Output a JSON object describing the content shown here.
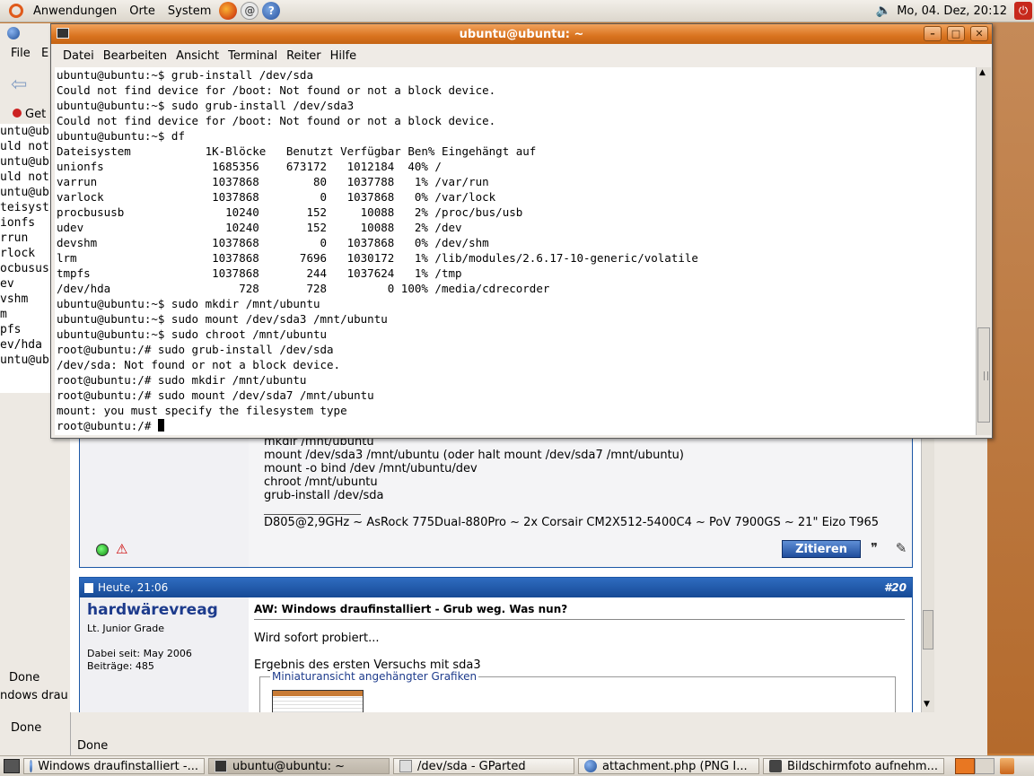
{
  "top_panel": {
    "menus": [
      "Anwendungen",
      "Orte",
      "System"
    ],
    "clock": "Mo, 04. Dez, 20:12",
    "icons": [
      "ubuntu-logo-icon",
      "firefox-icon",
      "mail-icon",
      "help-icon",
      "volume-icon",
      "power-icon"
    ],
    "help_glyph": "?",
    "power_glyph": "⏻",
    "volume_glyph": "🔈"
  },
  "browser": {
    "menu_file": "File",
    "menu_edit": "E",
    "get_label": "Get",
    "term_list": [
      "untu@ub",
      "uld not",
      "untu@ub",
      "uld not",
      "untu@ub",
      "teisyst",
      "ionfs",
      "rrun",
      "rlock",
      "ocbusus",
      "ev",
      "vshm",
      "m",
      "pfs",
      "ev/hda",
      "untu@ub"
    ],
    "done_1": "Done",
    "tab_2": "ndows drau",
    "done_2": "Done",
    "status": "Done",
    "post1": {
      "code_lines": [
        "mkdir /mnt/ubuntu",
        "mount /dev/sda3 /mnt/ubuntu (oder halt mount /dev/sda7 /mnt/ubuntu)",
        "mount -o bind /dev /mnt/ubuntu/dev",
        "chroot /mnt/ubuntu",
        "grub-install /dev/sda"
      ],
      "signature": "D805@2,9GHz ~ AsRock 775Dual-880Pro ~ 2x Corsair CM2X512-5400C4 ~ PoV 7900GS ~ 21\" Eizo T965",
      "quote_button": "Zitieren",
      "multiquote_glyph": "❞",
      "edit_glyph": "✎",
      "warn_glyph": "⚠"
    },
    "post2": {
      "date": "Heute, 21:06",
      "number": "#20",
      "username": "hardwärevreag",
      "rank": "Lt. Junior Grade",
      "joined": "Dabei seit: May 2006",
      "posts": "Beiträge: 485",
      "title": "AW: Windows draufinstalliert - Grub weg. Was nun?",
      "text_1": "Wird sofort probiert...",
      "text_2": "Ergebnis des ersten Versuchs mit sda3",
      "attachments_legend": "Miniaturansicht angehängter Grafiken"
    }
  },
  "terminal": {
    "title": "ubuntu@ubuntu: ~",
    "minimize_glyph": "–",
    "maximize_glyph": "□",
    "close_glyph": "✕",
    "menus": [
      "Datei",
      "Bearbeiten",
      "Ansicht",
      "Terminal",
      "Reiter",
      "Hilfe"
    ],
    "lines": [
      "ubuntu@ubuntu:~$ grub-install /dev/sda",
      "Could not find device for /boot: Not found or not a block device.",
      "ubuntu@ubuntu:~$ sudo grub-install /dev/sda3",
      "Could not find device for /boot: Not found or not a block device.",
      "ubuntu@ubuntu:~$ df",
      "Dateisystem           1K-Blöcke   Benutzt Verfügbar Ben% Eingehängt auf",
      "unionfs                1685356    673172   1012184  40% /",
      "varrun                 1037868        80   1037788   1% /var/run",
      "varlock                1037868         0   1037868   0% /var/lock",
      "procbususb               10240       152     10088   2% /proc/bus/usb",
      "udev                     10240       152     10088   2% /dev",
      "devshm                 1037868         0   1037868   0% /dev/shm",
      "lrm                    1037868      7696   1030172   1% /lib/modules/2.6.17-10-generic/volatile",
      "tmpfs                  1037868       244   1037624   1% /tmp",
      "/dev/hda                   728       728         0 100% /media/cdrecorder",
      "ubuntu@ubuntu:~$ sudo mkdir /mnt/ubuntu",
      "ubuntu@ubuntu:~$ sudo mount /dev/sda3 /mnt/ubuntu",
      "ubuntu@ubuntu:~$ sudo chroot /mnt/ubuntu",
      "root@ubuntu:/# sudo grub-install /dev/sda",
      "/dev/sda: Not found or not a block device.",
      "root@ubuntu:/# sudo mkdir /mnt/ubuntu",
      "root@ubuntu:/# sudo mount /dev/sda7 /mnt/ubuntu",
      "mount: you must specify the filesystem type"
    ],
    "prompt": "root@ubuntu:/# "
  },
  "taskbar": {
    "tasks": [
      "Windows draufinstalliert -...",
      "ubuntu@ubuntu: ~",
      "/dev/sda - GParted",
      "attachment.php (PNG I...",
      "Bildschirmfoto aufnehm..."
    ]
  }
}
